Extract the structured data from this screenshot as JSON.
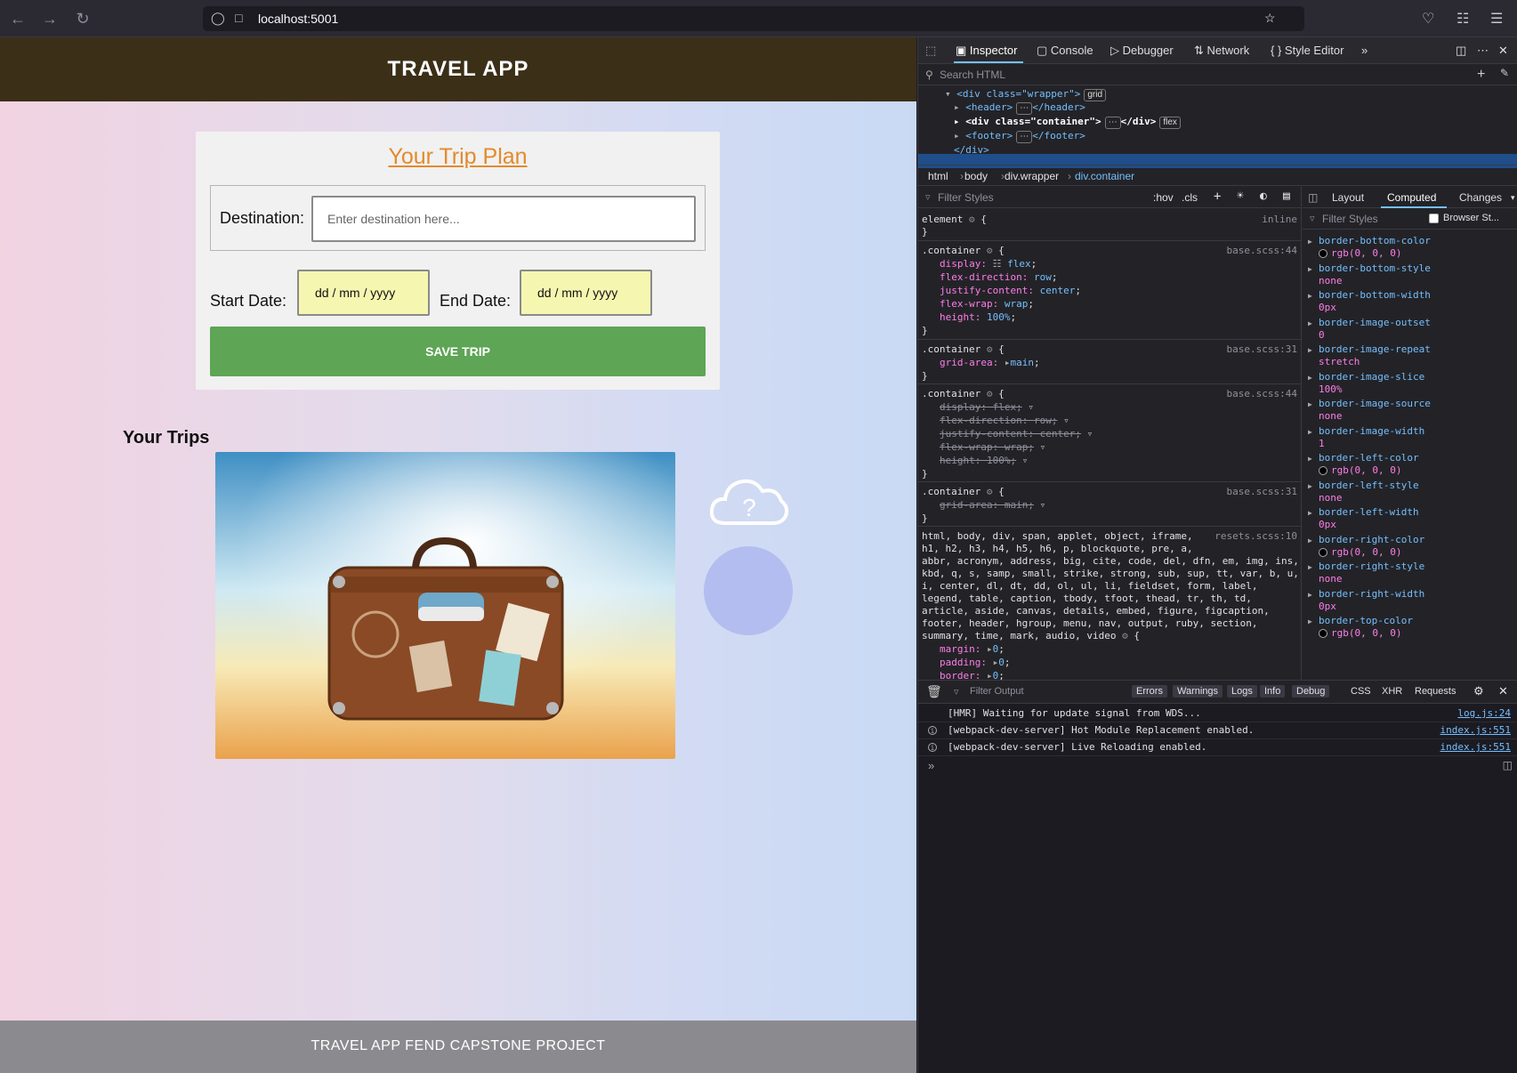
{
  "browser": {
    "url": "localhost:5001"
  },
  "app": {
    "title": "TRAVEL APP",
    "plan": {
      "title": "Your Trip Plan",
      "destination_label": "Destination:",
      "destination_placeholder": "Enter destination here...",
      "start_label": "Start Date:",
      "start_value": "dd / mm / yyyy",
      "end_label": "End Date:",
      "end_value": "dd / mm / yyyy",
      "save_label": "SAVE TRIP"
    },
    "trips_heading": "Your Trips",
    "weather_icon": "cloud-question-icon",
    "footer": "TRAVEL APP FEND CAPSTONE PROJECT",
    "colors": {
      "header": "#3b2f18",
      "save_button": "#5ea555",
      "title": "#e38a2d",
      "date_field": "#f5f6b0"
    }
  },
  "devtools": {
    "tabs": [
      "Inspector",
      "Console",
      "Debugger",
      "Network",
      "Style Editor"
    ],
    "active_tab": "Inspector",
    "search_placeholder": "Search HTML",
    "dom": {
      "wrapper_open": "<div class=\"wrapper\">",
      "wrapper_badge": "grid",
      "header": "<header>",
      "header_close": "</header>",
      "container_open": "<div class=\"container\">",
      "container_close": "</div>",
      "container_badge": "flex",
      "footer": "<footer>",
      "footer_close": "</footer>",
      "wrapper_close": "</div>"
    },
    "breadcrumb": [
      "html",
      "body",
      "div.wrapper",
      "div.container"
    ],
    "rules_filter": "Filter Styles",
    "rules_buttons": [
      ":hov",
      ".cls"
    ],
    "rules": {
      "element": "element",
      "inline": "inline",
      "container": ".container",
      "src_44": "base.scss:44",
      "src_31": "base.scss:31",
      "src_reset": "resets.scss:10",
      "display": "display:",
      "flex": "flex",
      "flex_direction": "flex-direction:",
      "row": "row",
      "justify_content": "justify-content:",
      "center": "center",
      "flex_wrap": "flex-wrap:",
      "wrap": "wrap",
      "height": "height:",
      "h100": "100%",
      "grid_area": "grid-area:",
      "main": "main",
      "struck_display": "display: flex;",
      "struck_direction": "flex-direction: row;",
      "struck_justify": "justify-content: center;",
      "struck_wrap": "flex-wrap: wrap;",
      "struck_height": "height: 100%;",
      "struck_grid": "grid-area: main;",
      "reset_selector": [
        "html, body, div, span, applet, object, iframe,",
        "h1, h2, h3, h4, h5, h6, p, blockquote, pre, a,",
        "abbr, acronym, address, big, cite, code, del, dfn, em, img, ins,",
        "kbd, q, s, samp, small, strike, strong, sub, sup, tt, var, b, u,",
        "i, center, dl, dt, dd, ol, ul, li, fieldset, form, label,",
        "legend, table, caption, tbody, tfoot, thead, tr, th, td,",
        "article, aside, canvas, details, embed, figure, figcaption,",
        "footer, header, hgroup, menu, nav, output, ruby, section,",
        "summary, time, mark, audio, video"
      ],
      "margin": "margin:",
      "padding": "padding:",
      "border": "border:",
      "zero": "0"
    },
    "computed_tabs": [
      "Layout",
      "Computed",
      "Changes"
    ],
    "computed_filter": "Filter Styles",
    "browser_styles": "Browser St...",
    "computed": [
      {
        "name": "border-bottom-color",
        "value": "rgb(0, 0, 0)",
        "swatch": true
      },
      {
        "name": "border-bottom-style",
        "value": "none"
      },
      {
        "name": "border-bottom-width",
        "value": "0px"
      },
      {
        "name": "border-image-outset",
        "value": "0"
      },
      {
        "name": "border-image-repeat",
        "value": "stretch"
      },
      {
        "name": "border-image-slice",
        "value": "100%"
      },
      {
        "name": "border-image-source",
        "value": "none"
      },
      {
        "name": "border-image-width",
        "value": "1"
      },
      {
        "name": "border-left-color",
        "value": "rgb(0, 0, 0)",
        "swatch": true
      },
      {
        "name": "border-left-style",
        "value": "none"
      },
      {
        "name": "border-left-width",
        "value": "0px"
      },
      {
        "name": "border-right-color",
        "value": "rgb(0, 0, 0)",
        "swatch": true
      },
      {
        "name": "border-right-style",
        "value": "none"
      },
      {
        "name": "border-right-width",
        "value": "0px"
      },
      {
        "name": "border-top-color",
        "value": "rgb(0, 0, 0)",
        "swatch": true
      }
    ],
    "console": {
      "filter_placeholder": "Filter Output",
      "levels": [
        "Errors",
        "Warnings",
        "Logs",
        "Info",
        "Debug"
      ],
      "extra_tabs": [
        "CSS",
        "XHR",
        "Requests"
      ],
      "messages": [
        {
          "text": "[HMR] Waiting for update signal from WDS...",
          "loc": "log.js:24",
          "info": false
        },
        {
          "text": "[webpack-dev-server] Hot Module Replacement enabled.",
          "loc": "index.js:551",
          "info": true
        },
        {
          "text": "[webpack-dev-server] Live Reloading enabled.",
          "loc": "index.js:551",
          "info": true
        }
      ]
    }
  }
}
